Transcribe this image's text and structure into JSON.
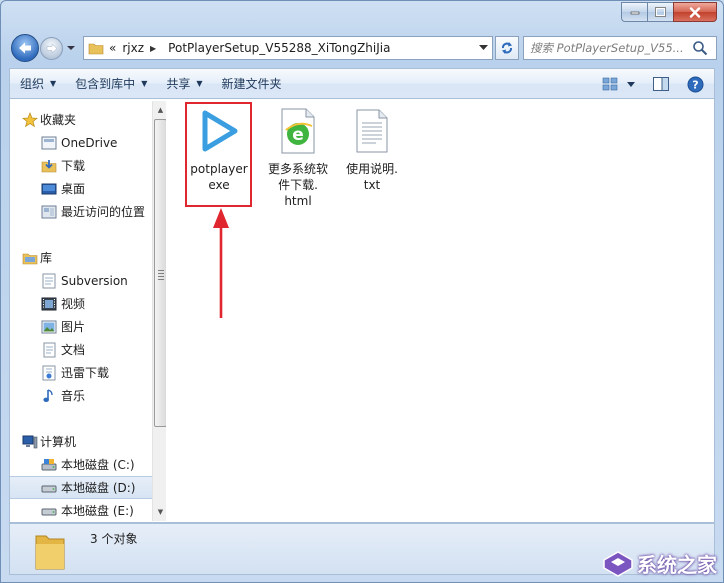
{
  "window": {
    "colors": {
      "frame": "#c9dbef",
      "accent_red": "#e0262e",
      "link_text": "#1e395b"
    }
  },
  "address": {
    "overflow": "«",
    "crumbs": [
      "rjxz",
      "PotPlayerSetup_V55288_XiTongZhiJia"
    ]
  },
  "search": {
    "placeholder": "搜索 PotPlayerSetup_V55..."
  },
  "toolbar": {
    "organize": "组织",
    "include_in_library": "包含到库中",
    "share": "共享",
    "new_folder": "新建文件夹"
  },
  "sidebar": {
    "favorites": {
      "label": "收藏夹",
      "items": [
        {
          "label": "OneDrive",
          "icon": "onedrive-icon"
        },
        {
          "label": "下载",
          "icon": "downloads-icon"
        },
        {
          "label": "桌面",
          "icon": "desktop-icon"
        },
        {
          "label": "最近访问的位置",
          "icon": "recent-places-icon"
        }
      ]
    },
    "libraries": {
      "label": "库",
      "items": [
        {
          "label": "Subversion",
          "icon": "subversion-icon"
        },
        {
          "label": "视频",
          "icon": "videos-icon"
        },
        {
          "label": "图片",
          "icon": "pictures-icon"
        },
        {
          "label": "文档",
          "icon": "documents-icon"
        },
        {
          "label": "迅雷下载",
          "icon": "thunder-download-icon"
        },
        {
          "label": "音乐",
          "icon": "music-icon"
        }
      ]
    },
    "computer": {
      "label": "计算机",
      "items": [
        {
          "label": "本地磁盘 (C:)",
          "icon": "drive-c-icon",
          "selected": false
        },
        {
          "label": "本地磁盘 (D:)",
          "icon": "drive-icon",
          "selected": true
        },
        {
          "label": "本地磁盘 (E:)",
          "icon": "drive-icon",
          "selected": false
        }
      ]
    }
  },
  "files": [
    {
      "name": "potplayer.exe",
      "line1": "potplayer",
      "line2": "exe",
      "icon": "potplayer-play-icon"
    },
    {
      "name": "更多系统软件下载.html",
      "line1": "更多系统软",
      "line2": "件下载.",
      "line3": "html",
      "icon": "html-ie-icon"
    },
    {
      "name": "使用说明.txt",
      "line1": "使用说明.",
      "line2": "txt",
      "icon": "text-file-icon"
    }
  ],
  "status": {
    "count_text": "3 个对象"
  },
  "watermark": {
    "text": "系统之家"
  }
}
